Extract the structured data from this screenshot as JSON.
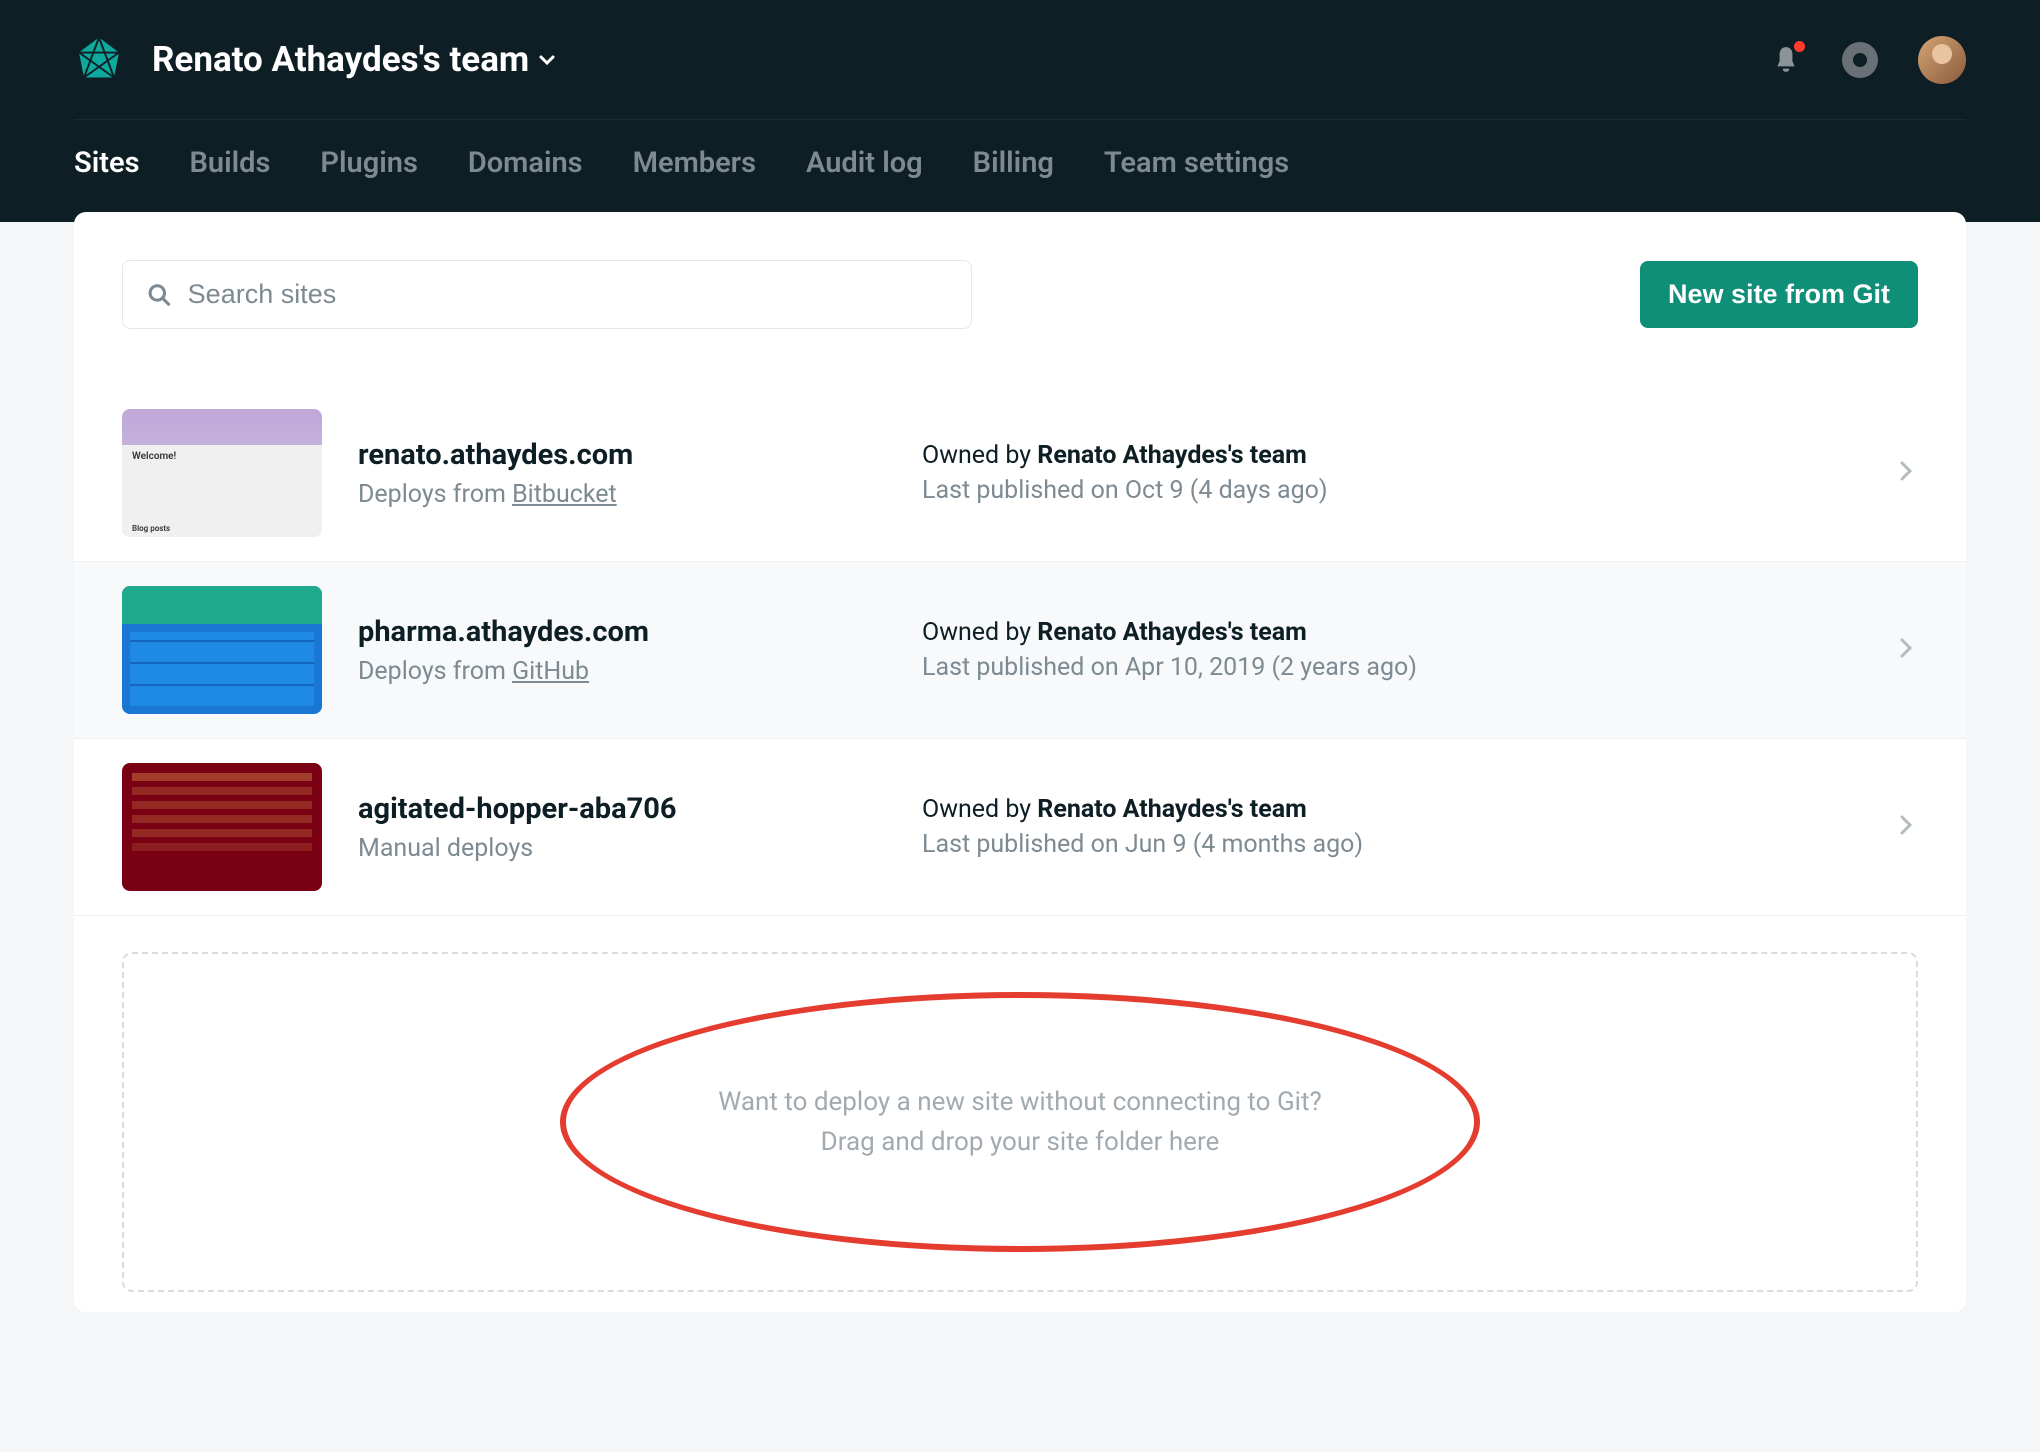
{
  "header": {
    "team_name": "Renato Athaydes's team"
  },
  "nav": {
    "tabs": [
      {
        "label": "Sites",
        "active": true
      },
      {
        "label": "Builds",
        "active": false
      },
      {
        "label": "Plugins",
        "active": false
      },
      {
        "label": "Domains",
        "active": false
      },
      {
        "label": "Members",
        "active": false
      },
      {
        "label": "Audit log",
        "active": false
      },
      {
        "label": "Billing",
        "active": false
      },
      {
        "label": "Team settings",
        "active": false
      }
    ]
  },
  "toolbar": {
    "search_placeholder": "Search sites",
    "new_site_label": "New site from Git"
  },
  "sites": [
    {
      "name": "renato.athaydes.com",
      "deploy_prefix": "Deploys from ",
      "deploy_source": "Bitbucket",
      "owner_prefix": "Owned by ",
      "owner": "Renato Athaydes's team",
      "published": "Last published on Oct 9 (4 days ago)",
      "thumb_class": "thumb1"
    },
    {
      "name": "pharma.athaydes.com",
      "deploy_prefix": "Deploys from ",
      "deploy_source": "GitHub",
      "owner_prefix": "Owned by ",
      "owner": "Renato Athaydes's team",
      "published": "Last published on Apr 10, 2019 (2 years ago)",
      "thumb_class": "thumb2"
    },
    {
      "name": "agitated-hopper-aba706",
      "deploy_prefix": "",
      "deploy_source": "Manual deploys",
      "owner_prefix": "Owned by ",
      "owner": "Renato Athaydes's team",
      "published": "Last published on Jun 9 (4 months ago)",
      "thumb_class": "thumb3"
    }
  ],
  "dropzone": {
    "line1": "Want to deploy a new site without connecting to Git?",
    "line2": "Drag and drop your site folder here"
  }
}
